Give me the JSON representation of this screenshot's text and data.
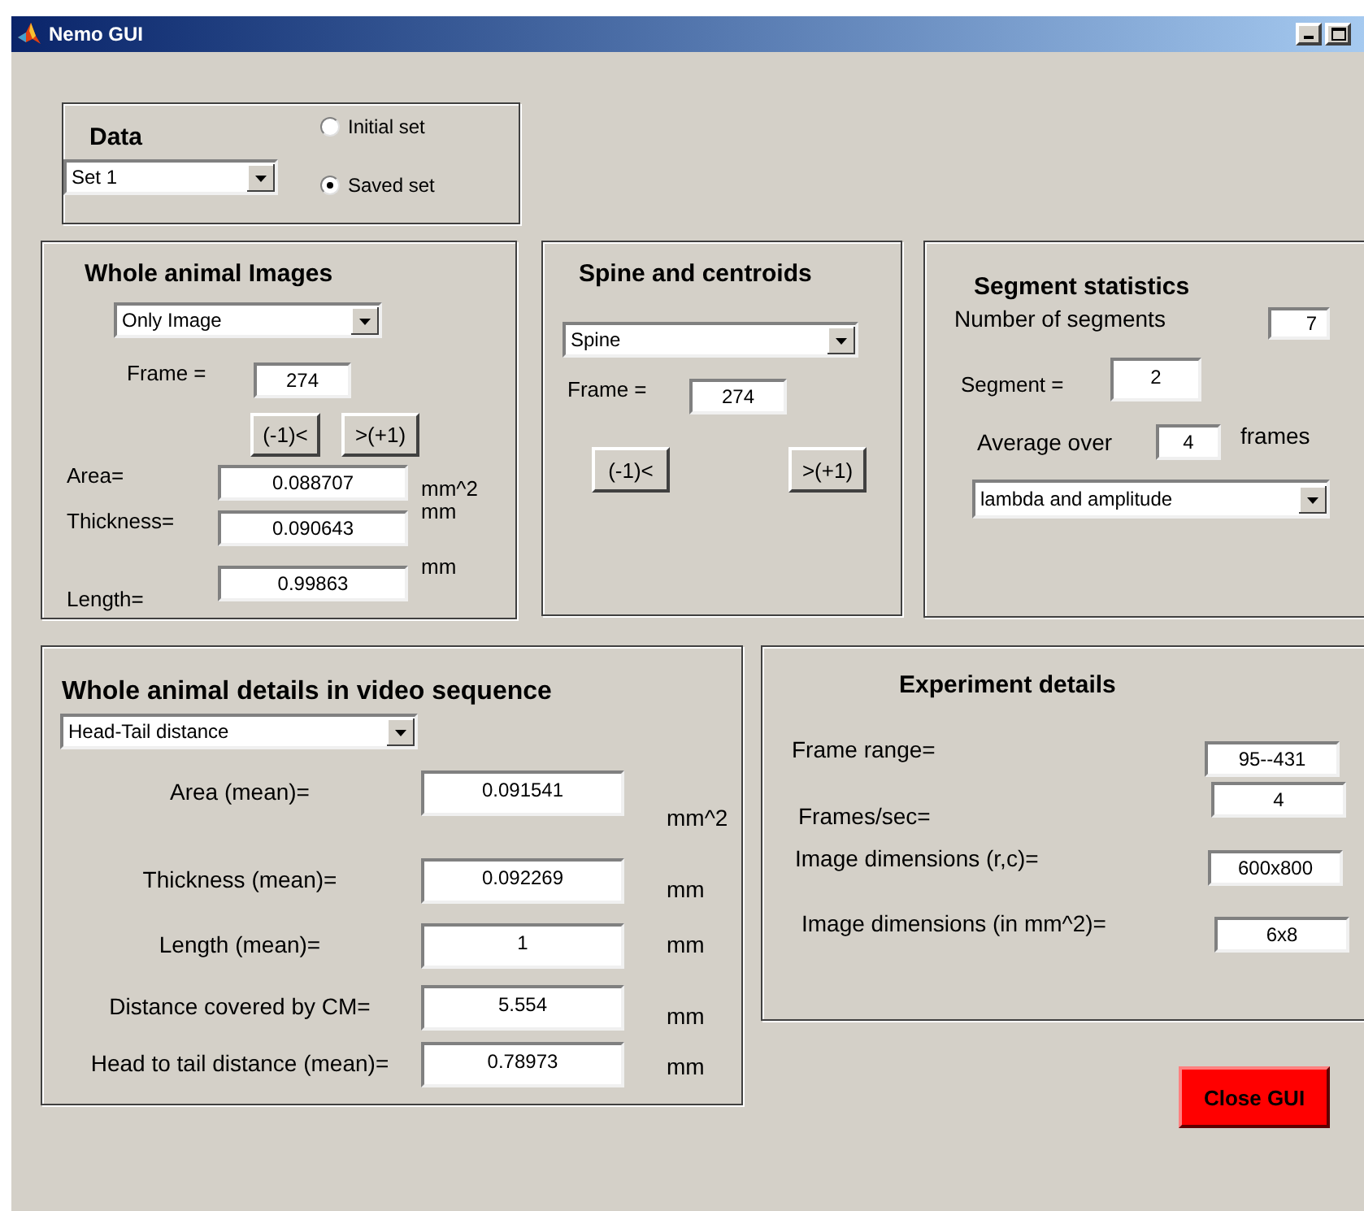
{
  "window": {
    "title": "Nemo GUI"
  },
  "data_panel": {
    "title": "Data",
    "dropdown": "Set 1",
    "radios": [
      {
        "label": "Initial set",
        "selected": false
      },
      {
        "label": "Saved set",
        "selected": true
      }
    ]
  },
  "whole_animal_images": {
    "title": "Whole animal Images",
    "dropdown": "Only Image",
    "frame": {
      "label": "Frame =",
      "value": "274"
    },
    "buttons": [
      "(-1)<",
      ">(+1)"
    ],
    "measurements": [
      {
        "label": "Area=",
        "value": "0.088707",
        "unit": "mm^2"
      },
      {
        "label": "Thickness=",
        "value": "0.090643",
        "unit": "mm"
      },
      {
        "label": "Length=",
        "value": "0.99863",
        "unit": "mm"
      }
    ]
  },
  "spine_and_centroids": {
    "title": "Spine and centroids",
    "dropdown": "Spine",
    "frame": {
      "label": "Frame =",
      "value": "274"
    },
    "buttons": [
      "(-1)<",
      ">(+1)"
    ]
  },
  "segment_statistics": {
    "title": "Segment statistics",
    "number_of_segments": {
      "label": "Number of segments",
      "value": "7"
    },
    "segment": {
      "label": "Segment =",
      "value": "2"
    },
    "average_over": {
      "label": "Average over",
      "value": "4",
      "unit": "frames"
    },
    "dropdown": "lambda and amplitude"
  },
  "video_details": {
    "title": "Whole animal details in video sequence",
    "dropdown": "Head-Tail distance",
    "measurements": [
      {
        "label": "Area (mean)=",
        "value": "0.091541",
        "unit": "mm^2"
      },
      {
        "label": "Thickness (mean)=",
        "value": "0.092269",
        "unit": "mm"
      },
      {
        "label": "Length (mean)=",
        "value": "1",
        "unit": "mm"
      },
      {
        "label": "Distance covered by CM=",
        "value": "5.554",
        "unit": "mm"
      },
      {
        "label": "Head to tail distance (mean)=",
        "value": "0.78973",
        "unit": "mm"
      }
    ]
  },
  "experiment_details": {
    "title": "Experiment details",
    "fields": [
      {
        "label": "Frame range=",
        "value": "95--431"
      },
      {
        "label": "Frames/sec=",
        "value": "4"
      },
      {
        "label": "Image dimensions (r,c)=",
        "value": "600x800"
      },
      {
        "label": "Image dimensions (in mm^2)=",
        "value": "6x8"
      }
    ]
  },
  "close_button": "Close GUI"
}
